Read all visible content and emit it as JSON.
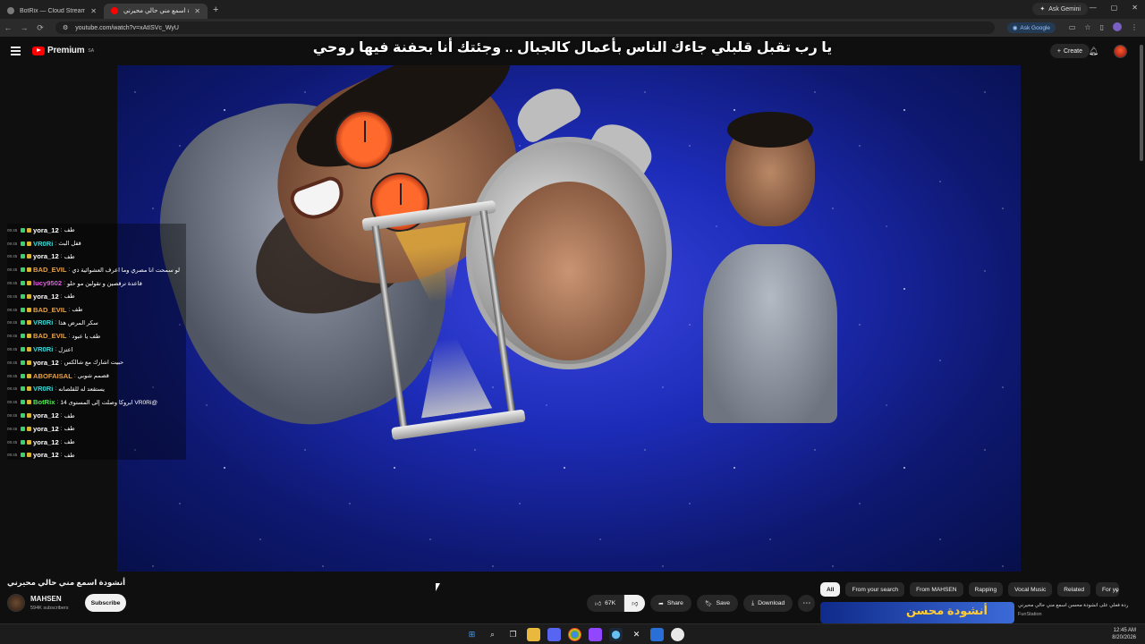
{
  "browser": {
    "tabs": [
      {
        "title": "BotRix — Cloud Streaming Bot",
        "favicon_color": "#7a7a7a",
        "active": false
      },
      {
        "title": "أنشودة اسمع مني حالي محيرني",
        "favicon_color": "#ff0000",
        "active": true
      }
    ],
    "new_tab": "+",
    "gemini": "Ask Gemini",
    "url": "youtube.com/watch?v=xAtISVc_WyU",
    "ask_google": "Ask Google",
    "window_controls": [
      "—",
      "▢",
      "✕"
    ]
  },
  "youtube": {
    "logo_text": "Premium",
    "logo_region": "SA",
    "create_label": "Create",
    "overlay_subtitle": "يا رب تقبل قلبلي جاءك الناس بأعمال كالجبال .. وجئتك أنا بحفنة فيها روحي",
    "video_title": "أنشودة اسمع مني حالي محيرني",
    "channel_name": "MAHSEN",
    "subscribers": "594K subscribers",
    "subscribe_label": "Subscribe",
    "actions": {
      "like_count": "67K",
      "share": "Share",
      "save": "Save",
      "download": "Download"
    },
    "chips": [
      "All",
      "From your search",
      "From MAHSEN",
      "Rapping",
      "Vocal Music",
      "Related",
      "For you"
    ],
    "recommended": {
      "thumb_text": "أنشودة محسن",
      "title": "ردة فعلي على أنشودة محسن اسمع مني حالي محيرني",
      "channel": "FunStation"
    }
  },
  "chat": [
    {
      "ts": "09:45",
      "user": "yora_12",
      "color": "#ffffff",
      "msg": "طف"
    },
    {
      "ts": "09:45",
      "user": "VR0Ri",
      "color": "#3ad8d8",
      "msg": "قفل البث"
    },
    {
      "ts": "09:45",
      "user": "yora_12",
      "color": "#ffffff",
      "msg": "طف"
    },
    {
      "ts": "09:45",
      "user": "BAD_EVIL",
      "color": "#e8a24a",
      "msg": "لو سمحت انا مصري وما اعرف العشوائية ذي"
    },
    {
      "ts": "09:45",
      "user": "lucy9502",
      "color": "#e05ce0",
      "msg": "قاعدة ترقصين و تقولين مو حلو"
    },
    {
      "ts": "09:45",
      "user": "yora_12",
      "color": "#ffffff",
      "msg": "طف"
    },
    {
      "ts": "09:45",
      "user": "BAD_EVIL",
      "color": "#e8a24a",
      "msg": "طف"
    },
    {
      "ts": "09:45",
      "user": "VR0Ri",
      "color": "#3ad8d8",
      "msg": "سكر المرض هذا"
    },
    {
      "ts": "09:45",
      "user": "BAD_EVIL",
      "color": "#e8a24a",
      "msg": "طف يا عبود"
    },
    {
      "ts": "09:45",
      "user": "VR0Ri",
      "color": "#3ad8d8",
      "msg": "اعتزل"
    },
    {
      "ts": "09:45",
      "user": "yora_12",
      "color": "#ffffff",
      "msg": "حبيت اشارك مع شالكس"
    },
    {
      "ts": "09:45",
      "user": "ABOFAISAL",
      "color": "#e8a24a",
      "msg": "قصمم شوبي"
    },
    {
      "ts": "09:45",
      "user": "VR0Ri",
      "color": "#3ad8d8",
      "msg": "يستقعد له للقلصانه"
    },
    {
      "ts": "09:45",
      "user": "BotRix",
      "color": "#53e653",
      "msg": "@VR0Ri ابروكا وصلت إلى المستوى 14"
    },
    {
      "ts": "09:45",
      "user": "yora_12",
      "color": "#ffffff",
      "msg": "طف"
    },
    {
      "ts": "09:45",
      "user": "yora_12",
      "color": "#ffffff",
      "msg": "طف"
    },
    {
      "ts": "09:45",
      "user": "yora_12",
      "color": "#ffffff",
      "msg": "طف"
    },
    {
      "ts": "09:45",
      "user": "yora_12",
      "color": "#ffffff",
      "msg": "طف"
    }
  ],
  "taskbar": {
    "icons": [
      "windows-start",
      "search",
      "task-view",
      "file-explorer",
      "discord",
      "chrome",
      "twitch",
      "steam",
      "capcut",
      "code",
      "obs"
    ],
    "time": "12:45 AM",
    "date": "8/20/2026"
  },
  "colors": {
    "accent_red": "#ff0000",
    "background": "#0f0f0f"
  }
}
